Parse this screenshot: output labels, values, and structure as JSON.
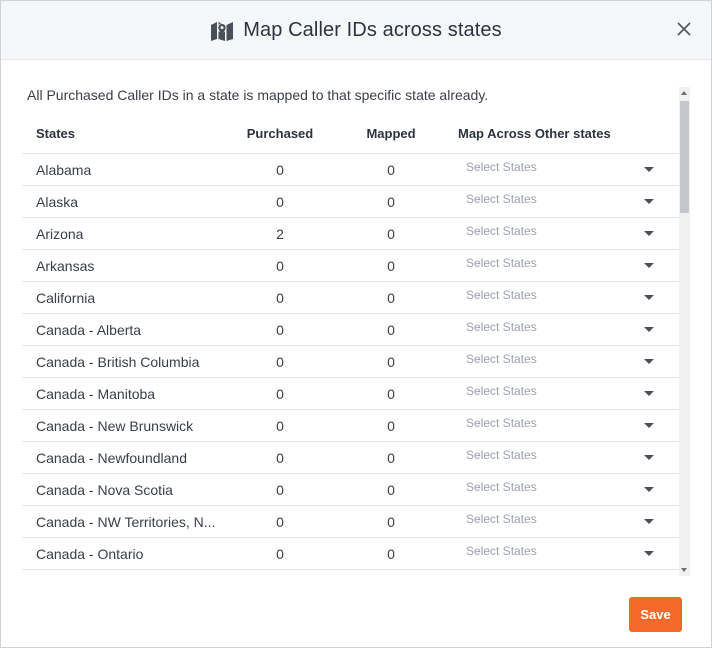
{
  "dialog": {
    "title": "Map Caller IDs across states",
    "title_icon": "map-icon",
    "close_icon": "close-icon"
  },
  "note": "All Purchased Caller IDs in a state is mapped to that specific state already.",
  "table": {
    "headers": {
      "states": "States",
      "purchased": "Purchased",
      "mapped": "Mapped",
      "map_across": "Map Across Other states"
    },
    "select_placeholder": "Select States",
    "rows": [
      {
        "state": "Alabama",
        "purchased": "0",
        "mapped": "0"
      },
      {
        "state": "Alaska",
        "purchased": "0",
        "mapped": "0"
      },
      {
        "state": "Arizona",
        "purchased": "2",
        "mapped": "0"
      },
      {
        "state": "Arkansas",
        "purchased": "0",
        "mapped": "0"
      },
      {
        "state": "California",
        "purchased": "0",
        "mapped": "0"
      },
      {
        "state": "Canada - Alberta",
        "purchased": "0",
        "mapped": "0"
      },
      {
        "state": "Canada - British Columbia",
        "purchased": "0",
        "mapped": "0"
      },
      {
        "state": "Canada - Manitoba",
        "purchased": "0",
        "mapped": "0"
      },
      {
        "state": "Canada - New Brunswick",
        "purchased": "0",
        "mapped": "0"
      },
      {
        "state": "Canada - Newfoundland",
        "purchased": "0",
        "mapped": "0"
      },
      {
        "state": "Canada - Nova Scotia",
        "purchased": "0",
        "mapped": "0"
      },
      {
        "state": "Canada - NW Territories, N...",
        "purchased": "0",
        "mapped": "0"
      },
      {
        "state": "Canada - Ontario",
        "purchased": "0",
        "mapped": "0"
      }
    ]
  },
  "footer": {
    "save_label": "Save"
  },
  "colors": {
    "accent": "#f46a2a",
    "header_bg": "#f6f7f9"
  }
}
